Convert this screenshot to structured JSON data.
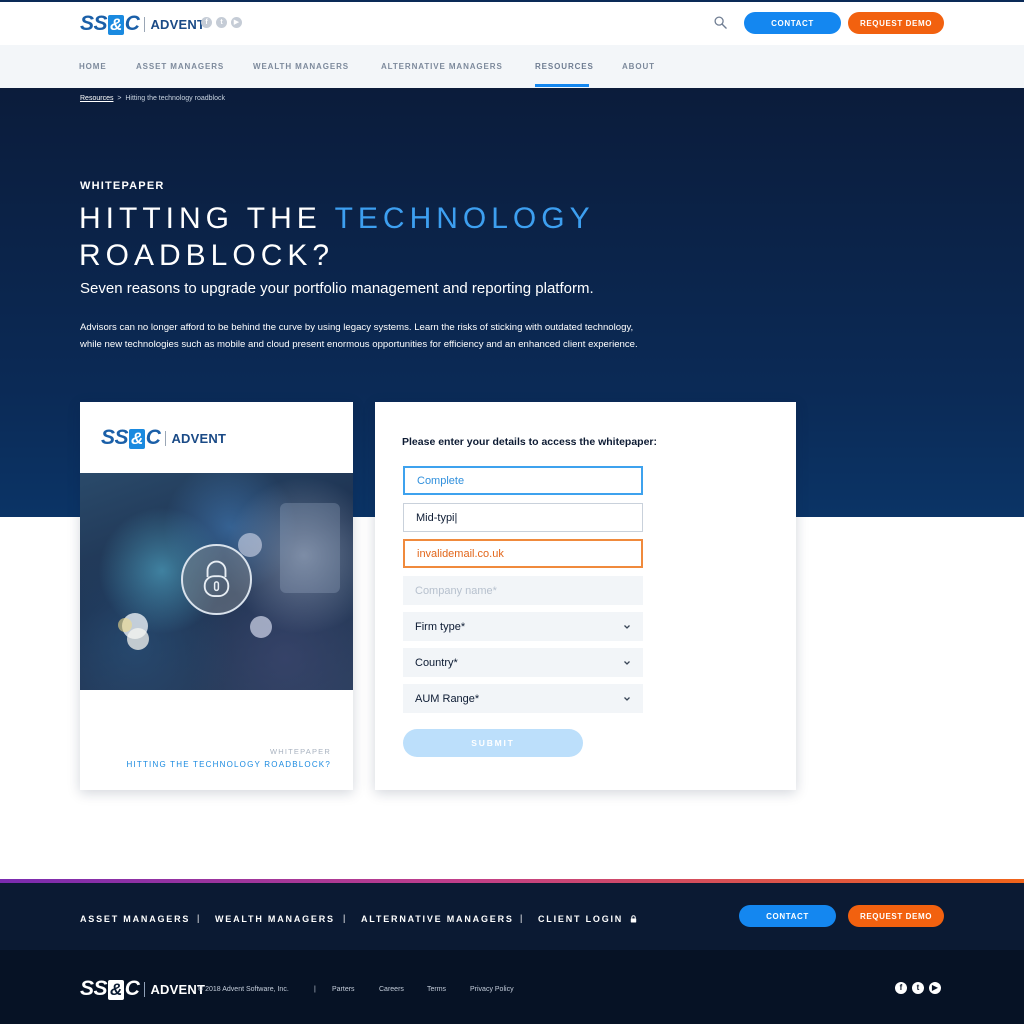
{
  "brand": {
    "logo_left": "SS",
    "logo_amp": "&",
    "logo_right": "C",
    "logo_word": "ADVENT"
  },
  "header": {
    "social": [
      "f",
      "t",
      "▶"
    ],
    "contact_label": "CONTACT",
    "demo_label": "REQUEST DEMO"
  },
  "nav": {
    "items": [
      "HOME",
      "ASSET MANAGERS",
      "WEALTH MANAGERS",
      "ALTERNATIVE MANAGERS",
      "RESOURCES",
      "ABOUT"
    ],
    "active": "RESOURCES"
  },
  "breadcrumb": {
    "root": "Resources",
    "separator": ">",
    "current": "Hitting the technology roadblock"
  },
  "hero": {
    "kicker": "WHITEPAPER",
    "title_part1": "HITTING THE ",
    "title_highlight": "TECHNOLOGY",
    "title_part2": "ROADBLOCK?",
    "subtitle": "Seven reasons to upgrade your portfolio management and reporting platform.",
    "body": "Advisors can no longer afford to be behind the curve by using legacy systems. Learn the risks of sticking with outdated technology, while new technologies such as mobile and cloud present enormous opportunities for efficiency and an enhanced client experience."
  },
  "cover": {
    "kicker": "WHITEPAPER",
    "title": "HITTING THE TECHNOLOGY ROADBLOCK?"
  },
  "form": {
    "heading": "Please enter your details to access the whitepaper:",
    "field_complete": "Complete",
    "field_typing": "Mid-typi|",
    "field_invalid": "invalidemail.co.uk",
    "company_placeholder": "Company name*",
    "firm_type": "Firm type*",
    "country": "Country*",
    "aum_range": "AUM Range*",
    "submit_label": "SUBMIT"
  },
  "footer": {
    "links": [
      "ASSET MANAGERS",
      "WEALTH MANAGERS",
      "ALTERNATIVE MANAGERS",
      "CLIENT LOGIN"
    ],
    "separator": "|",
    "contact_label": "CONTACT",
    "demo_label": "REQUEST DEMO",
    "copyright": "© 2018 Advent Software, Inc.",
    "legal_sep": "|",
    "legal_links": [
      "Parters",
      "Careers",
      "Terms",
      "Privacy Policy"
    ],
    "social": [
      "f",
      "t",
      "▶"
    ]
  },
  "colors": {
    "accent_blue": "#1487f0",
    "accent_orange": "#f2610f",
    "hero_navy": "#0b2a56",
    "footer_navy": "#0b1a33"
  }
}
